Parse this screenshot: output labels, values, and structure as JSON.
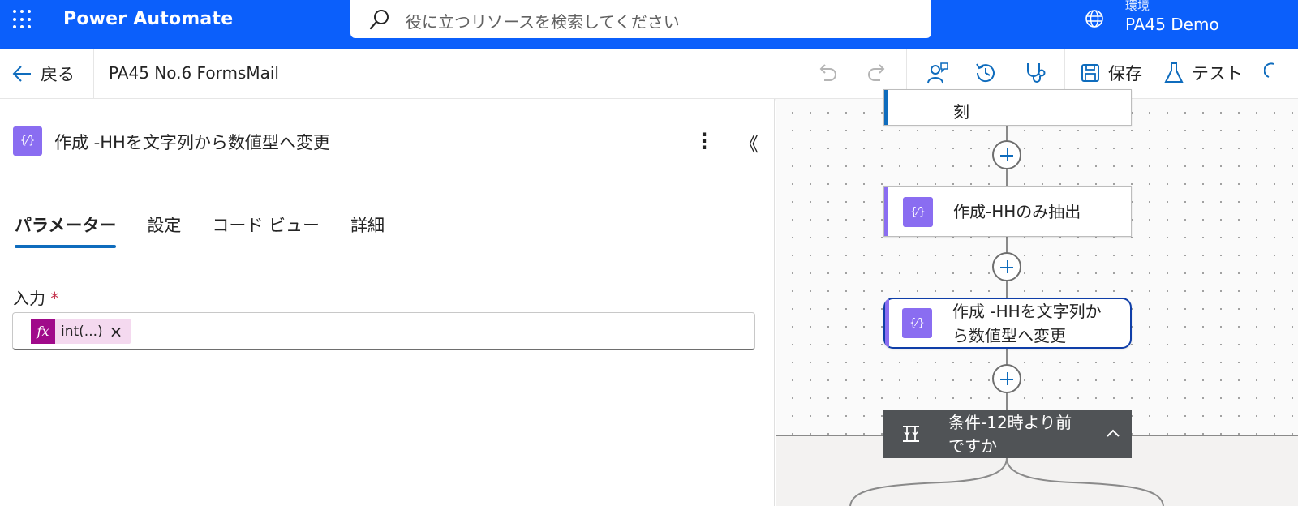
{
  "appbar": {
    "app_title": "Power Automate",
    "search_placeholder": "役に立つリソースを検索してください",
    "environment_label": "環境",
    "environment_value": "PA45 Demo"
  },
  "cmdbar": {
    "back_label": "戻る",
    "flow_name": "PA45 No.6 FormsMail",
    "save_label": "保存",
    "test_label": "テスト"
  },
  "pane": {
    "title": "作成 -HHを文字列から数値型へ変更",
    "tabs": [
      "パラメーター",
      "設定",
      "コード ビュー",
      "詳細"
    ],
    "field_label": "入力",
    "required_mark": "*",
    "token_fx": "fx",
    "token_text": "int(...)",
    "token_remove": "×"
  },
  "canvas": {
    "cards": [
      {
        "text": "刻",
        "accent": "#0f6cbd"
      },
      {
        "text": "作成-HHのみ抽出",
        "accent": "#8a6df1"
      },
      {
        "text": "作成 -HHを文字列か\nら数値型へ変更",
        "accent": "#8a6df1"
      }
    ],
    "condition": {
      "line1": "条件-12時より前",
      "line2": "ですか"
    }
  },
  "colors": {
    "brand": "#0b5ffb",
    "compose_icon": "#8a6df1",
    "selected_border": "#0f3ea8",
    "fx_token": "#a00a8a"
  }
}
